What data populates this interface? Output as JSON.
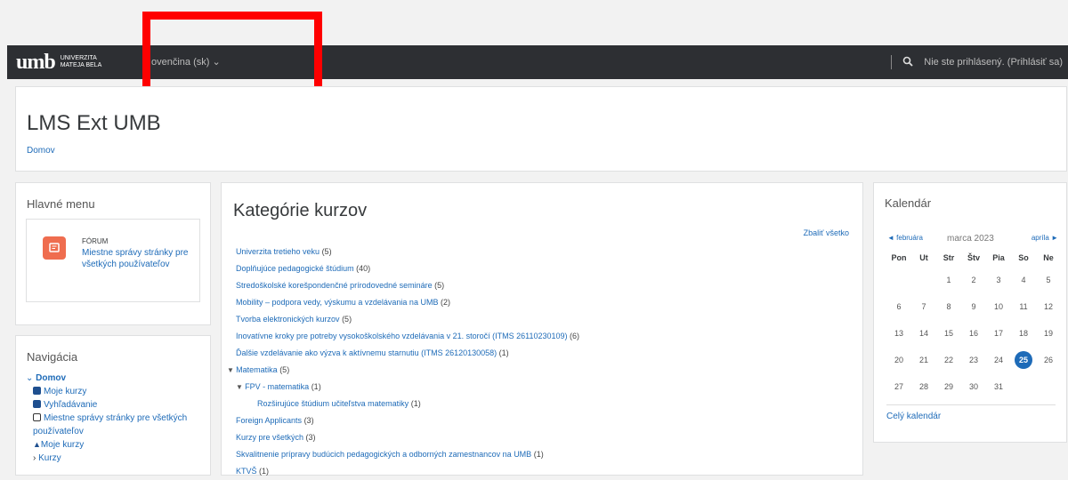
{
  "topbar": {
    "logo_mark": "umb",
    "logo_line1": "UNIVERZITA",
    "logo_line2": "MATEJA BELA",
    "language": "ovenčina (sk) ⌄",
    "login_text": "Nie ste prihlásený. (Prihlásiť sa)"
  },
  "header": {
    "title": "LMS Ext UMB",
    "breadcrumb": "Domov"
  },
  "main_menu": {
    "title": "Hlavné menu",
    "forum_type": "FÓRUM",
    "forum_link": "Miestne správy stránky pre všetkých používateľov"
  },
  "navigation": {
    "title": "Navigácia",
    "items": [
      {
        "label": "Domov"
      },
      {
        "label": "Moje kurzy"
      },
      {
        "label": "Vyhľadávanie"
      },
      {
        "label": "Miestne správy stránky pre všetkých používateľov"
      },
      {
        "label": "Moje kurzy"
      },
      {
        "label": "Kurzy"
      }
    ]
  },
  "categories": {
    "title": "Kategórie kurzov",
    "collapse_all": "Zbaliť všetko",
    "items": [
      {
        "label": "Univerzita tretieho veku",
        "count": "(5)"
      },
      {
        "label": "Doplňujúce pedagogické štúdium",
        "count": "(40)"
      },
      {
        "label": "Stredoškolské korešpondenčné prírodovedné semináre",
        "count": "(5)"
      },
      {
        "label": "Mobility – podpora vedy, výskumu a vzdelávania na UMB",
        "count": "(2)"
      },
      {
        "label": "Tvorba elektronických kurzov",
        "count": "(5)"
      },
      {
        "label": "Inovatívne kroky pre potreby vysokoškolského vzdelávania v 21. storočí (ITMS 26110230109)",
        "count": "(6)"
      },
      {
        "label": "Ďalšie vzdelávanie ako výzva k aktívnemu starnutiu (ITMS 26120130058)",
        "count": "(1)"
      },
      {
        "label": "Matematika",
        "count": "(5)"
      },
      {
        "label": "FPV - matematika",
        "count": "(1)"
      },
      {
        "label": "Rozširujúce štúdium učiteľstva matematiky",
        "count": "(1)"
      },
      {
        "label": "Foreign Applicants",
        "count": "(3)"
      },
      {
        "label": "Kurzy pre všetkých",
        "count": "(3)"
      },
      {
        "label": "Skvalitnenie prípravy budúcich pedagogických a odborných zamestnancov na UMB",
        "count": "(1)"
      },
      {
        "label": "KTVŠ",
        "count": "(1)"
      }
    ]
  },
  "calendar": {
    "title": "Kalendár",
    "prev": "◄ februára",
    "month": "marca 2023",
    "next": "apríla ►",
    "weekdays": [
      "Pon",
      "Ut",
      "Str",
      "Štv",
      "Pia",
      "So",
      "Ne"
    ],
    "weeks": [
      [
        "",
        "",
        "1",
        "2",
        "3",
        "4",
        "5"
      ],
      [
        "6",
        "7",
        "8",
        "9",
        "10",
        "11",
        "12"
      ],
      [
        "13",
        "14",
        "15",
        "16",
        "17",
        "18",
        "19"
      ],
      [
        "20",
        "21",
        "22",
        "23",
        "24",
        "25",
        "26"
      ],
      [
        "27",
        "28",
        "29",
        "30",
        "31",
        "",
        ""
      ]
    ],
    "today": "25",
    "full_calendar": "Celý kalendár"
  },
  "colors": {
    "topbar": "#2d2f33",
    "link": "#1e6bb8",
    "forum_icon": "#ef6d4f",
    "today": "#1e6bb8",
    "annotation": "#ff0000"
  }
}
